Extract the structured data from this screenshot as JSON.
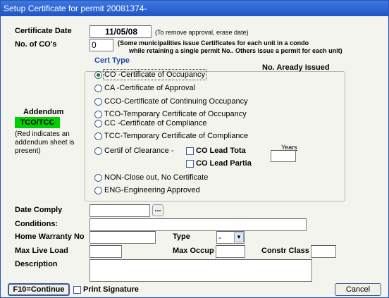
{
  "window": {
    "title": "Setup Certificate for permit  20081374-"
  },
  "form": {
    "certificate_date_label": "Certificate Date",
    "certificate_date_value": "11/05/08",
    "certificate_date_hint": "(To remove approval, erase date)",
    "num_cos_label": "No. of CO's",
    "num_cos_value": "0",
    "num_cos_hint_line1": "(Some municipalities issue Certificates for each unit in a condo",
    "num_cos_hint_line2": "while retaining a single permit No..  Others issue a permit for each unit)",
    "cert_type_label": "Cert Type",
    "already_issued_label": "No. Aready Issued",
    "date_comply_label": "Date Comply",
    "date_comply_value": "",
    "date_picker_label": "...",
    "conditions_label": "Conditions:",
    "conditions_value": "",
    "home_warranty_label": "Home Warranty No",
    "home_warranty_value": "",
    "type_label": "Type",
    "type_value": "-",
    "max_live_load_label": "Max Live Load",
    "max_live_load_value": "",
    "max_occup_label": "Max Occup",
    "max_occup_value": "",
    "constr_class_label": "Constr Class",
    "constr_class_value": "",
    "description_label": "Description",
    "description_value": ""
  },
  "cert_types": {
    "co": "CO  -Certificate of Occupancy",
    "ca": "CA  -Certificate of Approval",
    "cco": "CCO-Certificate of Continuing Occupancy",
    "tco": "TCO-Temporary Certificate of Occupancy",
    "cc": "CC  -Certificate of Compliance",
    "tcc": "TCC-Temporary Certificate of Compliance",
    "clearance": "Certif of Clearance -",
    "co_lead_total": "CO Lead Tota",
    "co_lead_partial": "CO Lead Partia",
    "years_label": "Years",
    "years_value": "",
    "non": "NON-Close out, No Certificate",
    "eng": "ENG-Engineering Approved"
  },
  "addendum": {
    "label": "Addendum",
    "badge": "TCO/TCC",
    "badge_color": "#00d000",
    "note_line1": "(Red indicates an",
    "note_line2": "addendum sheet is",
    "note_line3": "present)"
  },
  "footer": {
    "continue_label": "F10=Continue",
    "print_signature_label": "Print Signature",
    "cancel_label": "Cancel"
  },
  "colors": {
    "titlebar": "#2a63d4",
    "group_border": "#b9b9ae"
  }
}
